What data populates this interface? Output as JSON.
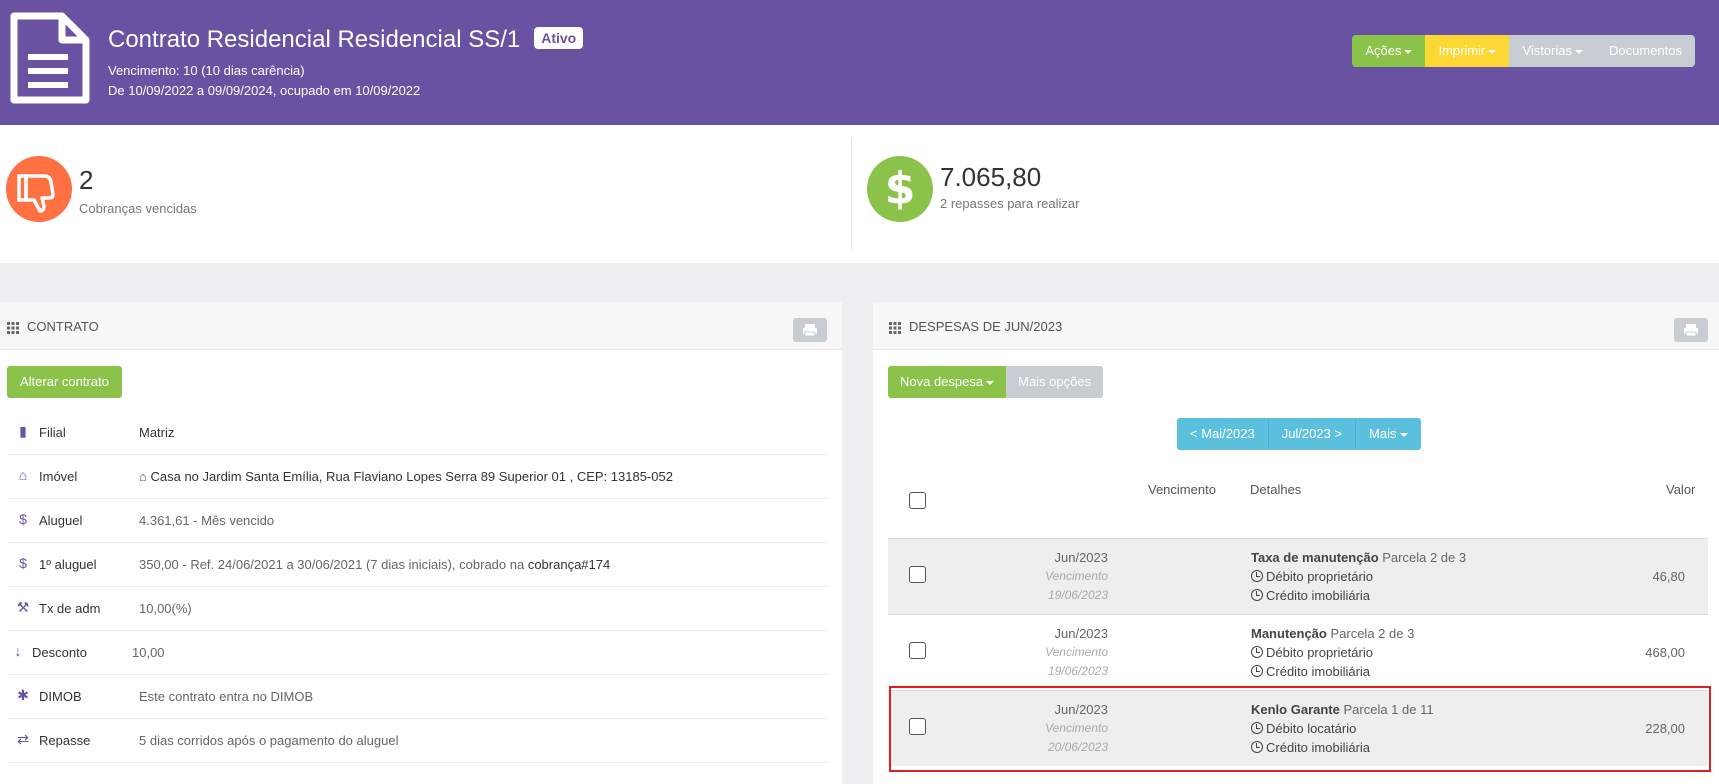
{
  "header": {
    "title": "Contrato Residencial Residencial SS/1",
    "status_badge": "Ativo",
    "line1": "Vencimento: 10 (10 dias carência)",
    "line2": "De 10/09/2022 a 09/09/2024, ocupado em 10/09/2022",
    "buttons": [
      {
        "label": "Ações",
        "color": "#8bc34a",
        "dropdown": true
      },
      {
        "label": "Imprimir",
        "color": "#fdd835",
        "dropdown": true
      },
      {
        "label": "Vistorias",
        "color": "#c8ccd3",
        "dropdown": true
      },
      {
        "label": "Documentos",
        "color": "#c8ccd3",
        "dropdown": false
      }
    ],
    "background_color": "#6a52a2"
  },
  "stats": {
    "overdue": {
      "value": "2",
      "label": "Cobranças vencidas",
      "icon": "thumbs-down-icon",
      "color": "#ff7043"
    },
    "transfers": {
      "value": "7.065,80",
      "label": "2 repasses para realizar",
      "icon": "dollar-icon",
      "color": "#8bc34a"
    }
  },
  "contract_panel": {
    "title": "CONTRATO",
    "alter_button": "Alterar contrato",
    "rows": [
      {
        "icon": "building-icon",
        "label": "Filial",
        "value": "Matriz"
      },
      {
        "icon": "home-icon",
        "label": "Imóvel",
        "value": "Casa no Jardim Santa Emília, Rua Flaviano Lopes Serra 89 Superior 01 , CEP: 13185-052"
      },
      {
        "icon": "dollar-icon",
        "label": "Aluguel",
        "value": "4.361,61 - Mês vencido"
      },
      {
        "icon": "dollar-icon",
        "label": "1º aluguel",
        "value": "350,00 - Ref. 24/06/2021 a 30/06/2021 (7 dias iniciais), cobrado na ",
        "link": "cobrança#174"
      },
      {
        "icon": "gavel-icon",
        "label": "Tx de adm",
        "value": "10,00(%)"
      },
      {
        "icon": "arrow-down-icon",
        "label": "Desconto",
        "value": "10,00"
      },
      {
        "icon": "asterisk-icon",
        "label": "DIMOB",
        "value": "Este contrato entra no DIMOB"
      },
      {
        "icon": "exchange-icon",
        "label": "Repasse",
        "value": "5 dias corridos após o pagamento do aluguel"
      }
    ]
  },
  "expenses_panel": {
    "title": "DESPESAS DE JUN/2023",
    "new_button": "Nova despesa",
    "more_options_button": "Mais opções",
    "nav": {
      "prev": "< Mai/2023",
      "next": "Jul/2023 >",
      "more": "Mais"
    },
    "columns": {
      "due": "Vencimento",
      "details": "Detalhes",
      "value": "Valor"
    },
    "rows": [
      {
        "month": "Jun/2023",
        "due_label": "Vencimento",
        "due_date": "19/06/2023",
        "name": "Taxa de manutenção",
        "installment": "Parcela 2 de 3",
        "debit": "Débito proprietário",
        "credit": "Crédito imobiliária",
        "value": "46,80"
      },
      {
        "month": "Jun/2023",
        "due_label": "Vencimento",
        "due_date": "19/06/2023",
        "name": "Manutenção",
        "installment": "Parcela 2 de 3",
        "debit": "Débito proprietário",
        "credit": "Crédito imobiliária",
        "value": "468,00"
      },
      {
        "month": "Jun/2023",
        "due_label": "Vencimento",
        "due_date": "20/06/2023",
        "name": "Kenlo Garante",
        "installment": "Parcela 1 de 11",
        "debit": "Débito locatário",
        "credit": "Crédito imobiliária",
        "value": "228,00"
      }
    ]
  }
}
